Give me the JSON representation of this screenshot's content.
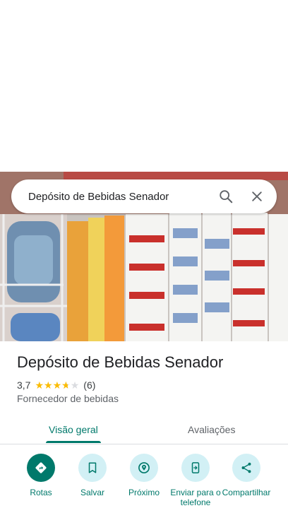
{
  "search": {
    "query": "Depósito de Bebidas Senador"
  },
  "place": {
    "name": "Depósito de Bebidas Senador",
    "rating": "3,7",
    "stars": 3.7,
    "review_count": "(6)",
    "category": "Fornecedor de bebidas"
  },
  "tabs": [
    {
      "label": "Visão geral",
      "active": true
    },
    {
      "label": "Avaliações",
      "active": false
    }
  ],
  "actions": [
    {
      "label": "Rotas",
      "icon": "directions-icon"
    },
    {
      "label": "Salvar",
      "icon": "bookmark-icon"
    },
    {
      "label": "Próximo",
      "icon": "nearby-icon"
    },
    {
      "label": "Enviar para o telefone",
      "icon": "send-to-phone-icon"
    },
    {
      "label": "Compartilhar",
      "icon": "share-icon"
    }
  ],
  "colors": {
    "accent": "#00796b",
    "star": "#fbbc04",
    "action_bg": "#d2f0f5"
  }
}
